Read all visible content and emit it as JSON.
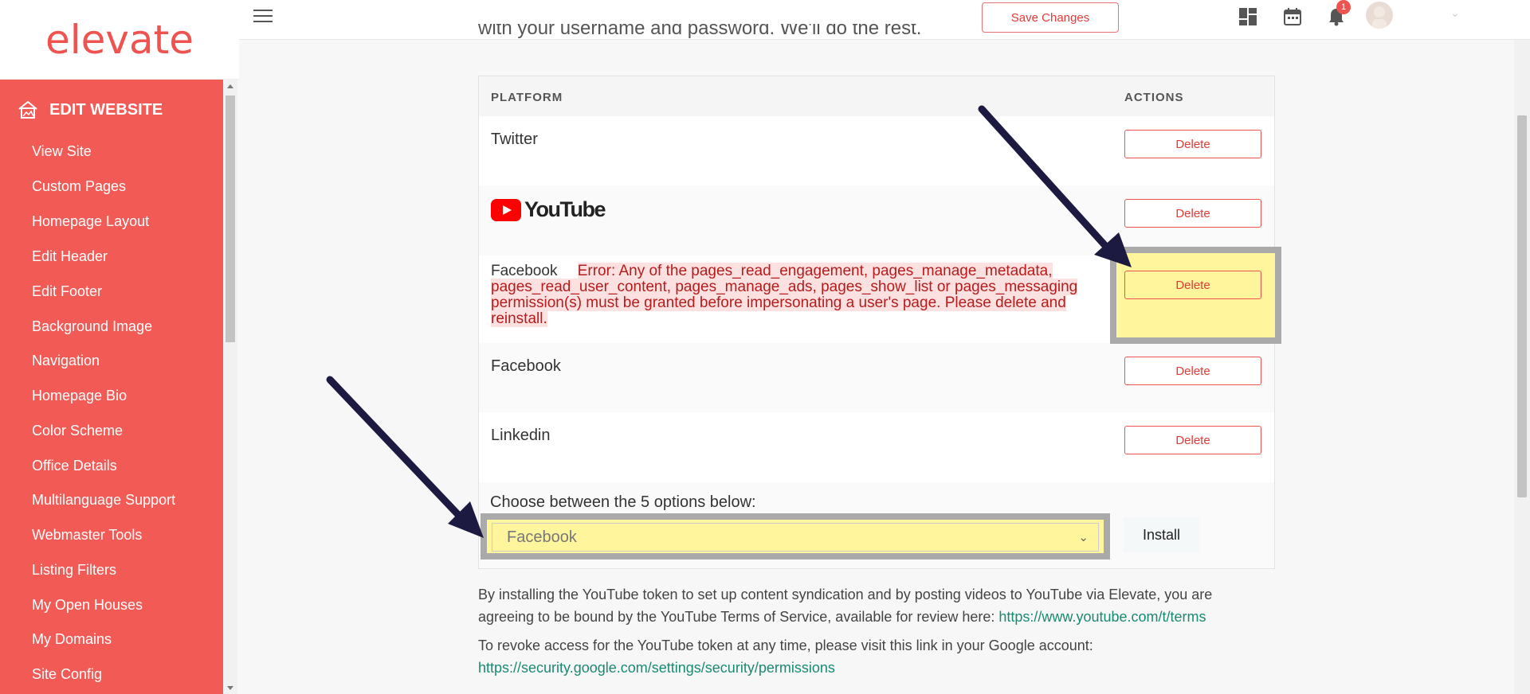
{
  "brand": {
    "logo": "elevate"
  },
  "sidebar": {
    "header": "EDIT WEBSITE",
    "items": [
      {
        "label": "View Site"
      },
      {
        "label": "Custom Pages"
      },
      {
        "label": "Homepage Layout"
      },
      {
        "label": "Edit Header"
      },
      {
        "label": "Edit Footer"
      },
      {
        "label": "Background Image"
      },
      {
        "label": "Navigation"
      },
      {
        "label": "Homepage Bio"
      },
      {
        "label": "Color Scheme"
      },
      {
        "label": "Office Details"
      },
      {
        "label": "Multilanguage Support"
      },
      {
        "label": "Webmaster Tools"
      },
      {
        "label": "Listing Filters"
      },
      {
        "label": "My Open Houses"
      },
      {
        "label": "My Domains"
      },
      {
        "label": "Site Config"
      }
    ]
  },
  "topbar": {
    "save_label": "Save Changes",
    "notification_count": "1"
  },
  "intro": {
    "cut_text": "with your username and password. We'll do the rest."
  },
  "table": {
    "headers": {
      "platform": "PLATFORM",
      "actions": "ACTIONS"
    },
    "rows": [
      {
        "name": "Twitter",
        "action": "Delete"
      },
      {
        "name": "YouTube",
        "action": "Delete"
      },
      {
        "name": "Facebook",
        "action": "Delete",
        "error": "Error: Any of the pages_read_engagement, pages_manage_metadata, pages_read_user_content, pages_manage_ads, pages_show_list or pages_messaging permission(s) must be granted before impersonating a user's page. Please delete and reinstall."
      },
      {
        "name": "Facebook",
        "action": "Delete"
      },
      {
        "name": "Linkedin",
        "action": "Delete"
      }
    ],
    "choose_label": "Choose between the 5 options below:",
    "select_value": "Facebook",
    "install_label": "Install"
  },
  "footer": {
    "p1_text": "By installing the YouTube token to set up content syndication and by posting videos to YouTube via Elevate, you are",
    "p1_text2": "agreeing to be bound by the YouTube Terms of Service, available for review here: ",
    "p1_link": "https://www.youtube.com/t/terms",
    "p2_text": "To revoke access for the YouTube token at any time, please visit this link in your Google account:",
    "p2_link": "https://security.google.com/settings/security/permissions"
  },
  "colors": {
    "accent": "#f25a55",
    "highlight": "#fff59d",
    "link": "#1a8a73",
    "arrow": "#1c1a40"
  }
}
